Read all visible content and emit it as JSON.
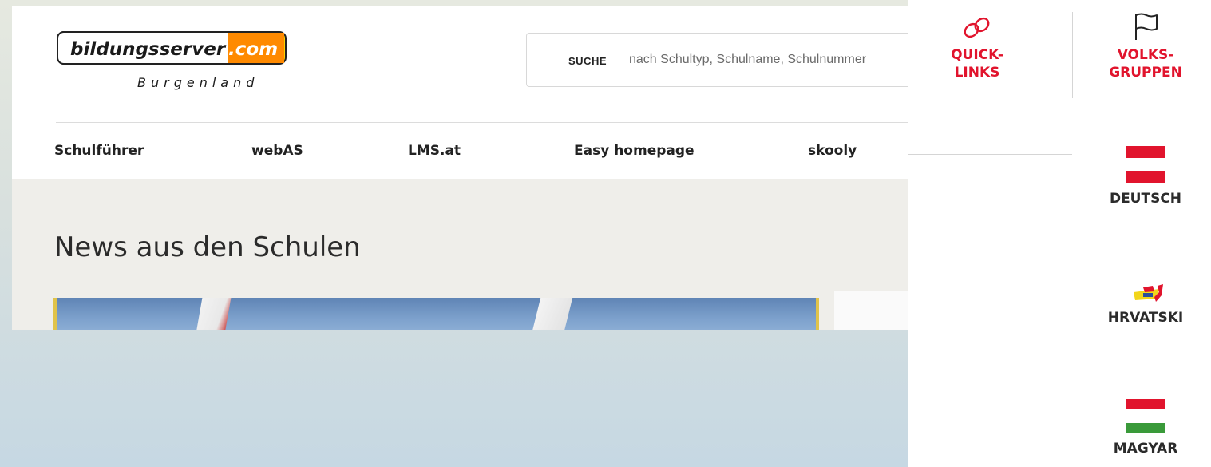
{
  "header": {
    "logo": {
      "brand_main": "bildungsserver",
      "brand_tld": ".com",
      "subtitle": "Burgenland"
    },
    "search": {
      "label": "SUCHE",
      "placeholder": "nach Schultyp, Schulname, Schulnummer"
    }
  },
  "nav": {
    "items": [
      {
        "label": "Schulführer"
      },
      {
        "label": "webAS"
      },
      {
        "label": "LMS.at"
      },
      {
        "label": "Easy homepage"
      },
      {
        "label": "skooly"
      }
    ]
  },
  "main": {
    "section_title": "News aus den Schulen"
  },
  "side_panel": {
    "quick_links": {
      "label": "QUICK-\nLINKS",
      "icon": "link-icon"
    },
    "volksgruppen": {
      "label": "VOLKS-\nGRUPPEN",
      "icon": "flag-outline-icon"
    },
    "languages": [
      {
        "label": "DEUTSCH",
        "icon": "austria-flag-icon"
      },
      {
        "label": "HRVATSKI",
        "icon": "croatian-flag-icon"
      },
      {
        "label": "MAGYAR",
        "icon": "hungary-flag-icon"
      }
    ]
  },
  "colors": {
    "accent_red": "#e1142d",
    "logo_orange": "#ff7a00",
    "logo_yellow": "#ffd200",
    "flag_red": "#e1142d",
    "hungary_green": "#3a9a3a"
  }
}
